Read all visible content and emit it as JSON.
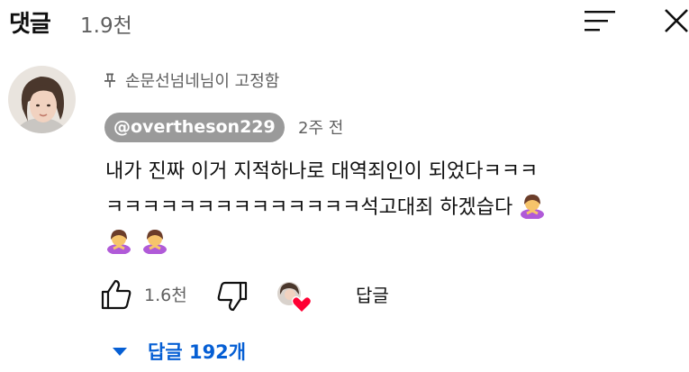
{
  "header": {
    "title": "댓글",
    "count": "1.9천",
    "sort_icon": "sort-icon",
    "close_icon": "close-icon"
  },
  "comment": {
    "pinned_label": "손문선넘네님이 고정함",
    "author": "@overtheson229",
    "time": "2주 전",
    "text_line1": "내가 진짜 이거 지적하나로 대역죄인이 되었다ㅋㅋㅋ",
    "text_line2": "ㅋㅋㅋㅋㅋㅋㅋㅋㅋㅋㅋㅋㅋㅋ석고대죄 하겠습다",
    "emoji": "person-bowing-emoji",
    "like_count": "1.6천",
    "reply_label": "답글",
    "creator_heart_icon": "creator-heart-icon"
  },
  "replies": {
    "label": "답글 192개",
    "icon": "caret-down-icon"
  },
  "colors": {
    "text": "#0f0f0f",
    "secondary": "#606060",
    "handle_bg": "#9a9a9a",
    "link_blue": "#065fd4",
    "heart": "#ff0033"
  }
}
